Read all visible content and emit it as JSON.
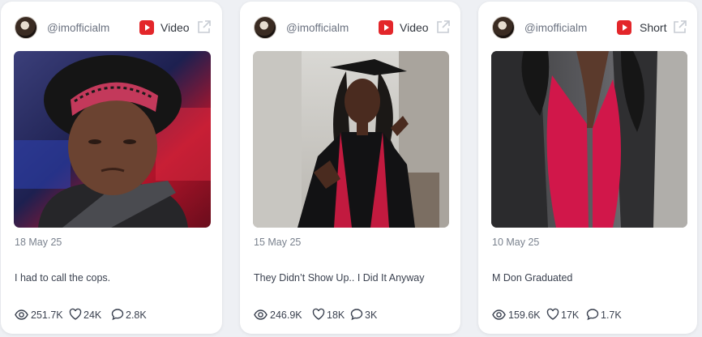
{
  "cards": [
    {
      "handle": "@imofficialm",
      "platform_icon": "youtube-icon",
      "content_type": "Video",
      "date": "18 May 25",
      "title": "I had to call the cops.",
      "views": "251.7K",
      "likes": "24K",
      "comments": "2.8K"
    },
    {
      "handle": "@imofficialm",
      "platform_icon": "youtube-icon",
      "content_type": "Video",
      "date": "15 May 25",
      "title": "They Didn’t Show Up.. I Did It Anyway",
      "views": "246.9K",
      "likes": "18K",
      "comments": "3K"
    },
    {
      "handle": "@imofficialm",
      "platform_icon": "youtube-icon",
      "content_type": "Short",
      "date": "10 May 25",
      "title": "M Don Graduated",
      "views": "159.6K",
      "likes": "17K",
      "comments": "1.7K"
    }
  ],
  "colors": {
    "youtube_red": "#e3262a",
    "text_muted": "#7a828e",
    "text_main": "#3b4250"
  }
}
